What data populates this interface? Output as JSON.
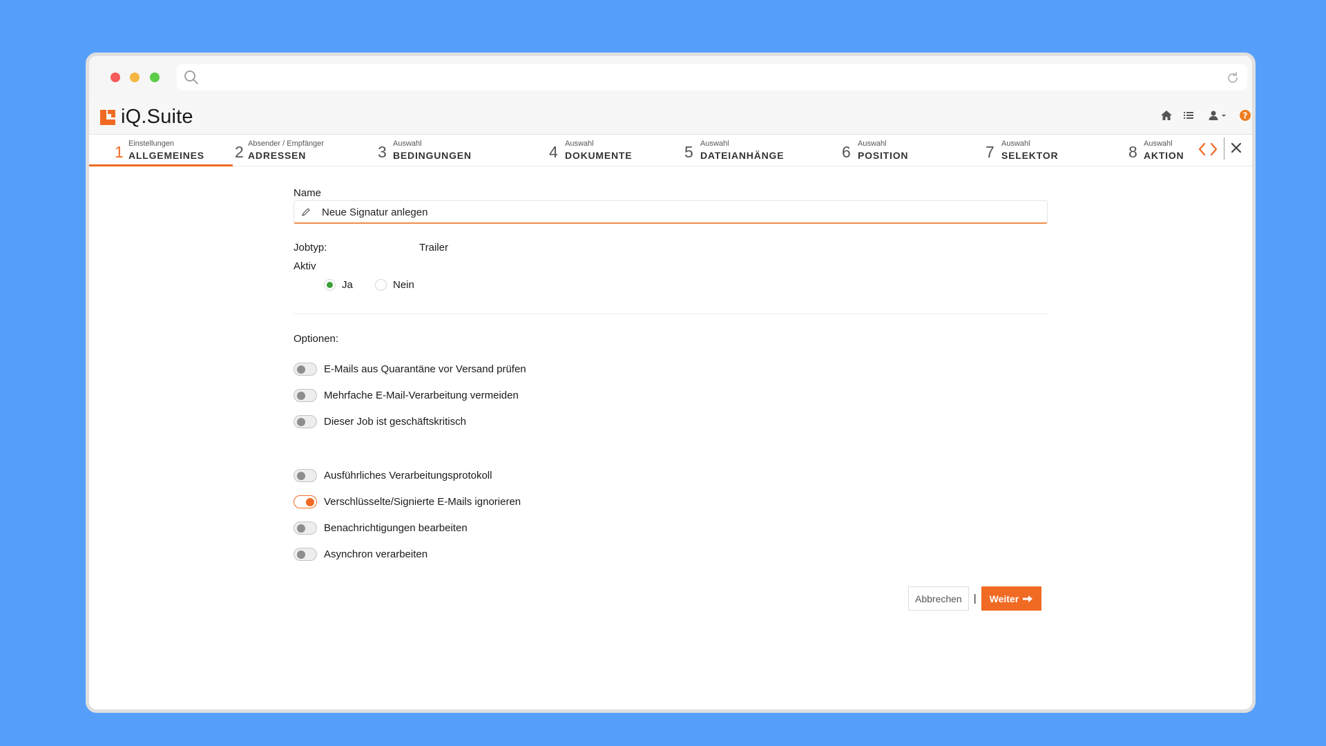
{
  "browser": {
    "url": "",
    "icons": [
      "search-icon",
      "reload-icon"
    ]
  },
  "app": {
    "name": "iQ.Suite",
    "accent": "#f06a23",
    "header_icons": [
      "home-icon",
      "list-icon",
      "user-icon",
      "help-icon"
    ]
  },
  "steps": [
    {
      "num": "1",
      "small": "Einstellungen",
      "label": "ALLGEMEINES",
      "active": true
    },
    {
      "num": "2",
      "small": "Absender / Empfänger",
      "label": "ADRESSEN",
      "active": false
    },
    {
      "num": "3",
      "small": "Auswahl",
      "label": "BEDINGUNGEN",
      "active": false
    },
    {
      "num": "4",
      "small": "Auswahl",
      "label": "DOKUMENTE",
      "active": false
    },
    {
      "num": "5",
      "small": "Auswahl",
      "label": "DATEIANHÄNGE",
      "active": false
    },
    {
      "num": "6",
      "small": "Auswahl",
      "label": "POSITION",
      "active": false
    },
    {
      "num": "7",
      "small": "Auswahl",
      "label": "SELEKTOR",
      "active": false
    },
    {
      "num": "8",
      "small": "Auswahl",
      "label": "AKTION",
      "active": false
    }
  ],
  "form": {
    "name_label": "Name",
    "name_value": "Neue Signatur anlegen",
    "jobtyp_label": "Jobtyp:",
    "jobtyp_value": "Trailer",
    "aktiv_label": "Aktiv",
    "aktiv_options": [
      {
        "label": "Ja",
        "checked": true
      },
      {
        "label": "Nein",
        "checked": false
      }
    ],
    "options_label": "Optionen:",
    "options": [
      {
        "label": "E-Mails aus Quarantäne vor Versand prüfen",
        "on": false
      },
      {
        "label": "Mehrfache E-Mail-Verarbeitung vermeiden",
        "on": false
      },
      {
        "label": "Dieser Job ist geschäftskritisch",
        "on": false
      },
      {
        "label": "Ausführliches Verarbeitungsprotokoll",
        "on": false
      },
      {
        "label": "Verschlüsselte/Signierte E-Mails ignorieren",
        "on": true
      },
      {
        "label": "Benachrichtigungen bearbeiten",
        "on": false
      },
      {
        "label": "Asynchron verarbeiten",
        "on": false
      }
    ]
  },
  "actions": {
    "cancel_label": "Abbrechen",
    "separator": "|",
    "next_label": "Weiter"
  }
}
